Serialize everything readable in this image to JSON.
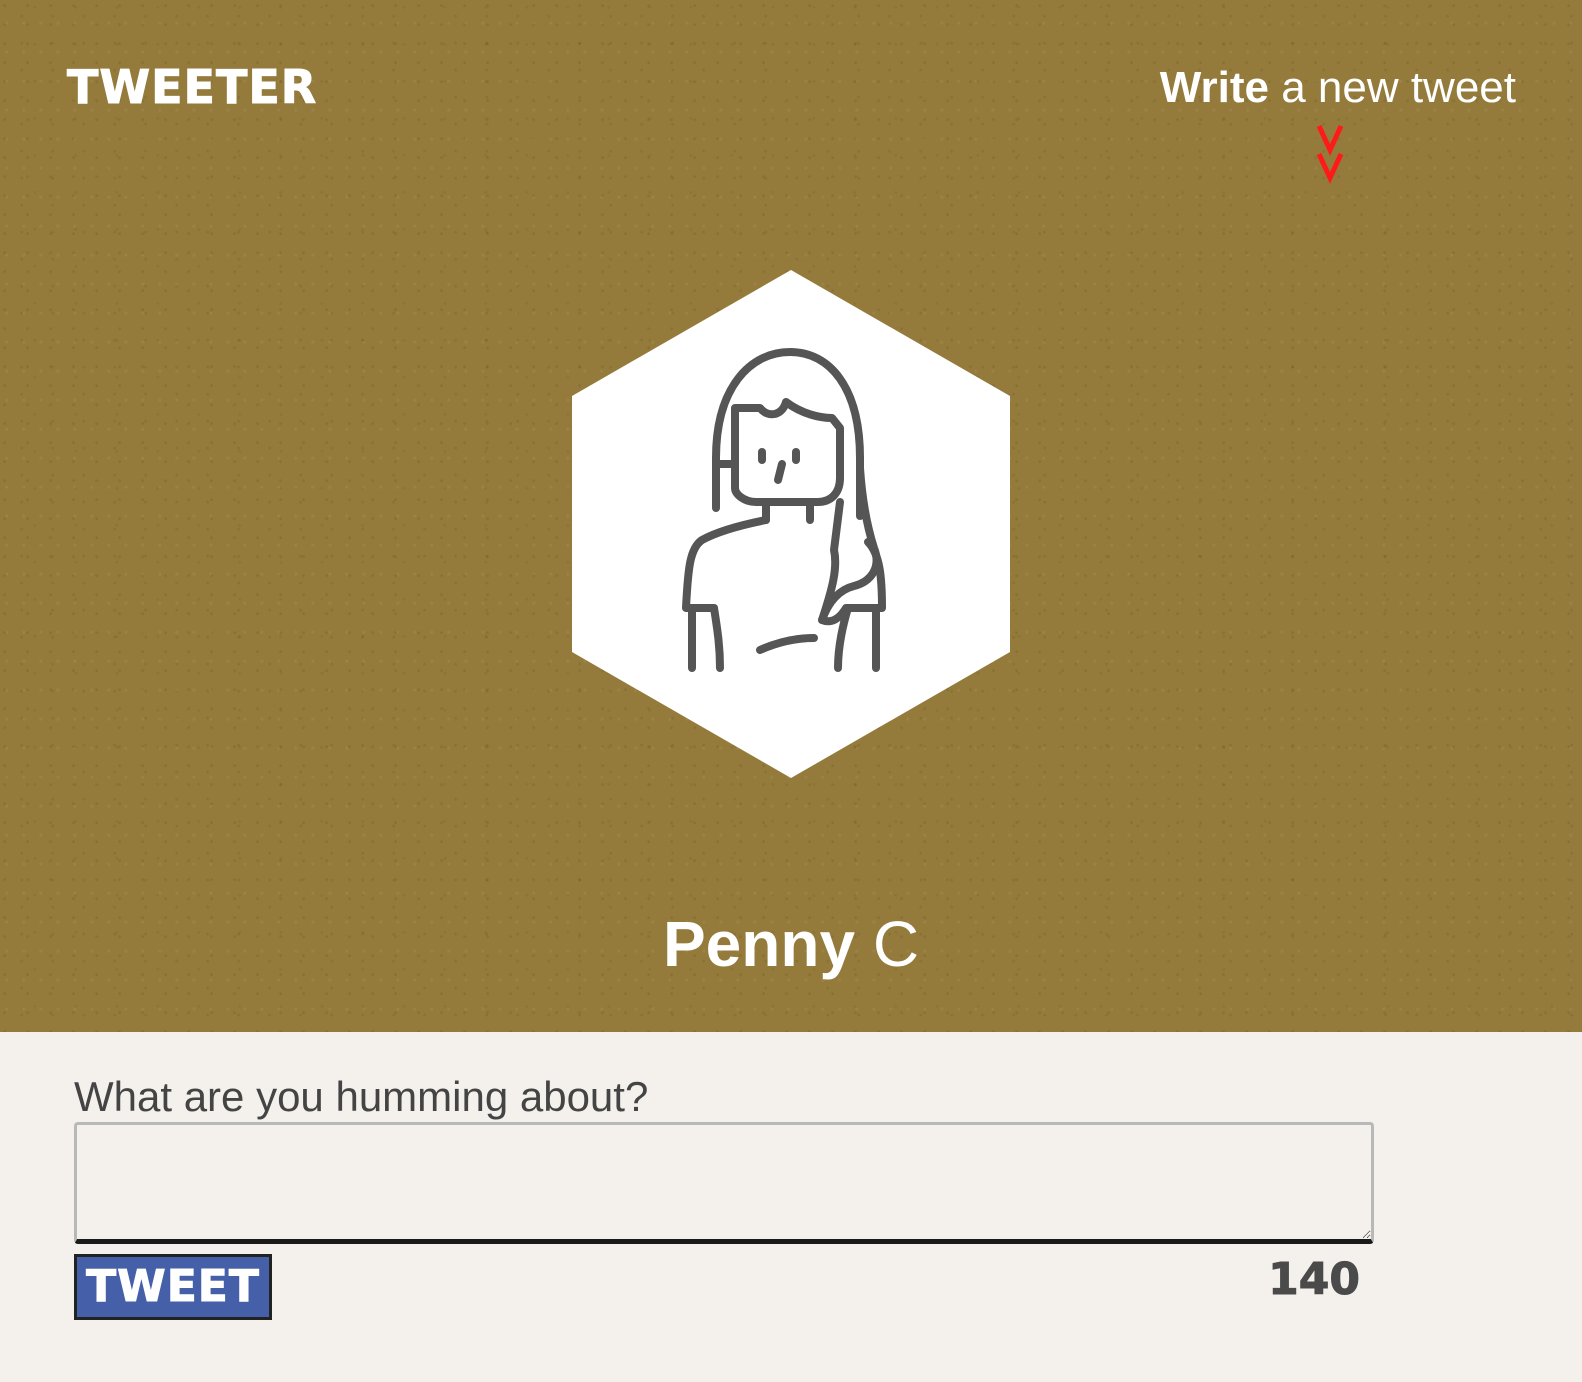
{
  "header": {
    "brand": "TWEETER",
    "write_bold": "Write",
    "write_rest": " a new tweet",
    "chevron_icon": "double-chevron-down-icon",
    "chevron_color": "#ff1a1a"
  },
  "profile": {
    "avatar_icon": "woman-avatar-icon",
    "first_name": "Penny",
    "last_name": "C"
  },
  "compose": {
    "label": "What are you humming about?",
    "value": "",
    "placeholder": "",
    "button_label": "TWEET",
    "char_count": "140"
  },
  "colors": {
    "hero_background": "#957b3b",
    "page_background": "#f4f1ec",
    "button_background": "#4560a8",
    "icon_stroke": "#555555"
  }
}
